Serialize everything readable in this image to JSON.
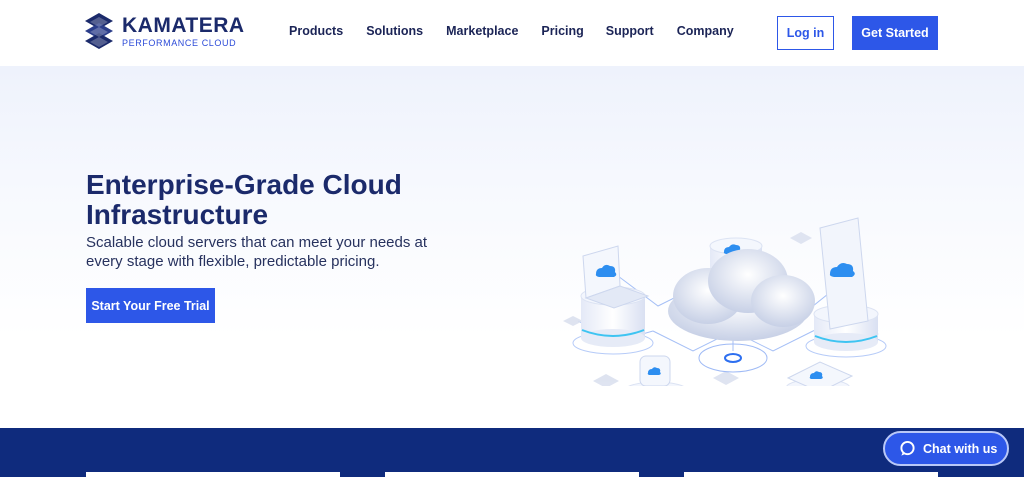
{
  "brand": {
    "name": "KAMATERA",
    "tagline": "PERFORMANCE CLOUD",
    "primary_color": "#2d57e8",
    "navy": "#1b2a6b"
  },
  "nav": {
    "items": [
      {
        "label": "Products"
      },
      {
        "label": "Solutions"
      },
      {
        "label": "Marketplace"
      },
      {
        "label": "Pricing"
      },
      {
        "label": "Support"
      },
      {
        "label": "Company"
      }
    ]
  },
  "header": {
    "login_label": "Log in",
    "get_started_label": "Get Started"
  },
  "hero": {
    "title": "Enterprise-Grade Cloud Infrastructure",
    "subtitle": "Scalable cloud servers that can meet your needs at every stage with flexible, predictable pricing.",
    "cta_label": "Start Your Free Trial",
    "illustration_icon": "cloud-network-illustration"
  },
  "chat": {
    "label": "Chat with us",
    "icon": "chat-bubble-icon"
  },
  "band": {
    "color": "#0f2b7d"
  }
}
